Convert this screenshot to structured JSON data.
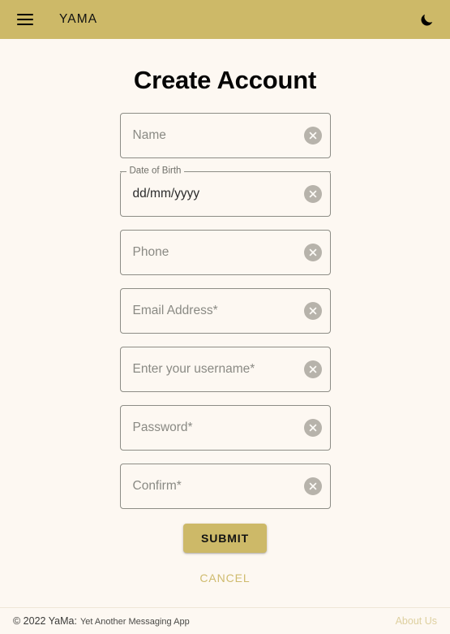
{
  "appbar": {
    "menu_icon": "hamburger-menu-icon",
    "title": "YAMA",
    "theme_icon": "moon-icon",
    "background": "#CDB968"
  },
  "main": {
    "title": "Create Account",
    "fields": [
      {
        "name": "name",
        "placeholder": "Name",
        "value": "",
        "floating_label": "",
        "clear_icon": "clear-icon"
      },
      {
        "name": "dob",
        "placeholder": "dd/mm/yyyy",
        "value": "dd/mm/yyyy",
        "floating_label": "Date of Birth",
        "clear_icon": "clear-icon"
      },
      {
        "name": "phone",
        "placeholder": "Phone",
        "value": "",
        "floating_label": "",
        "clear_icon": "clear-icon"
      },
      {
        "name": "email",
        "placeholder": "Email Address*",
        "value": "",
        "floating_label": "",
        "clear_icon": "clear-icon"
      },
      {
        "name": "username",
        "placeholder": "Enter your username*",
        "value": "",
        "floating_label": "",
        "clear_icon": "clear-icon"
      },
      {
        "name": "password",
        "placeholder": "Password*",
        "value": "",
        "floating_label": "",
        "clear_icon": "clear-icon"
      },
      {
        "name": "confirm",
        "placeholder": "Confirm*",
        "value": "",
        "floating_label": "",
        "clear_icon": "clear-icon"
      }
    ],
    "submit_label": "SUBMIT",
    "cancel_label": "CANCEL"
  },
  "footer": {
    "copyright": "© 2022 YaMa:",
    "tagline": "Yet Another Messaging App",
    "about_label": "About Us",
    "about_color": "#DED0A0"
  }
}
